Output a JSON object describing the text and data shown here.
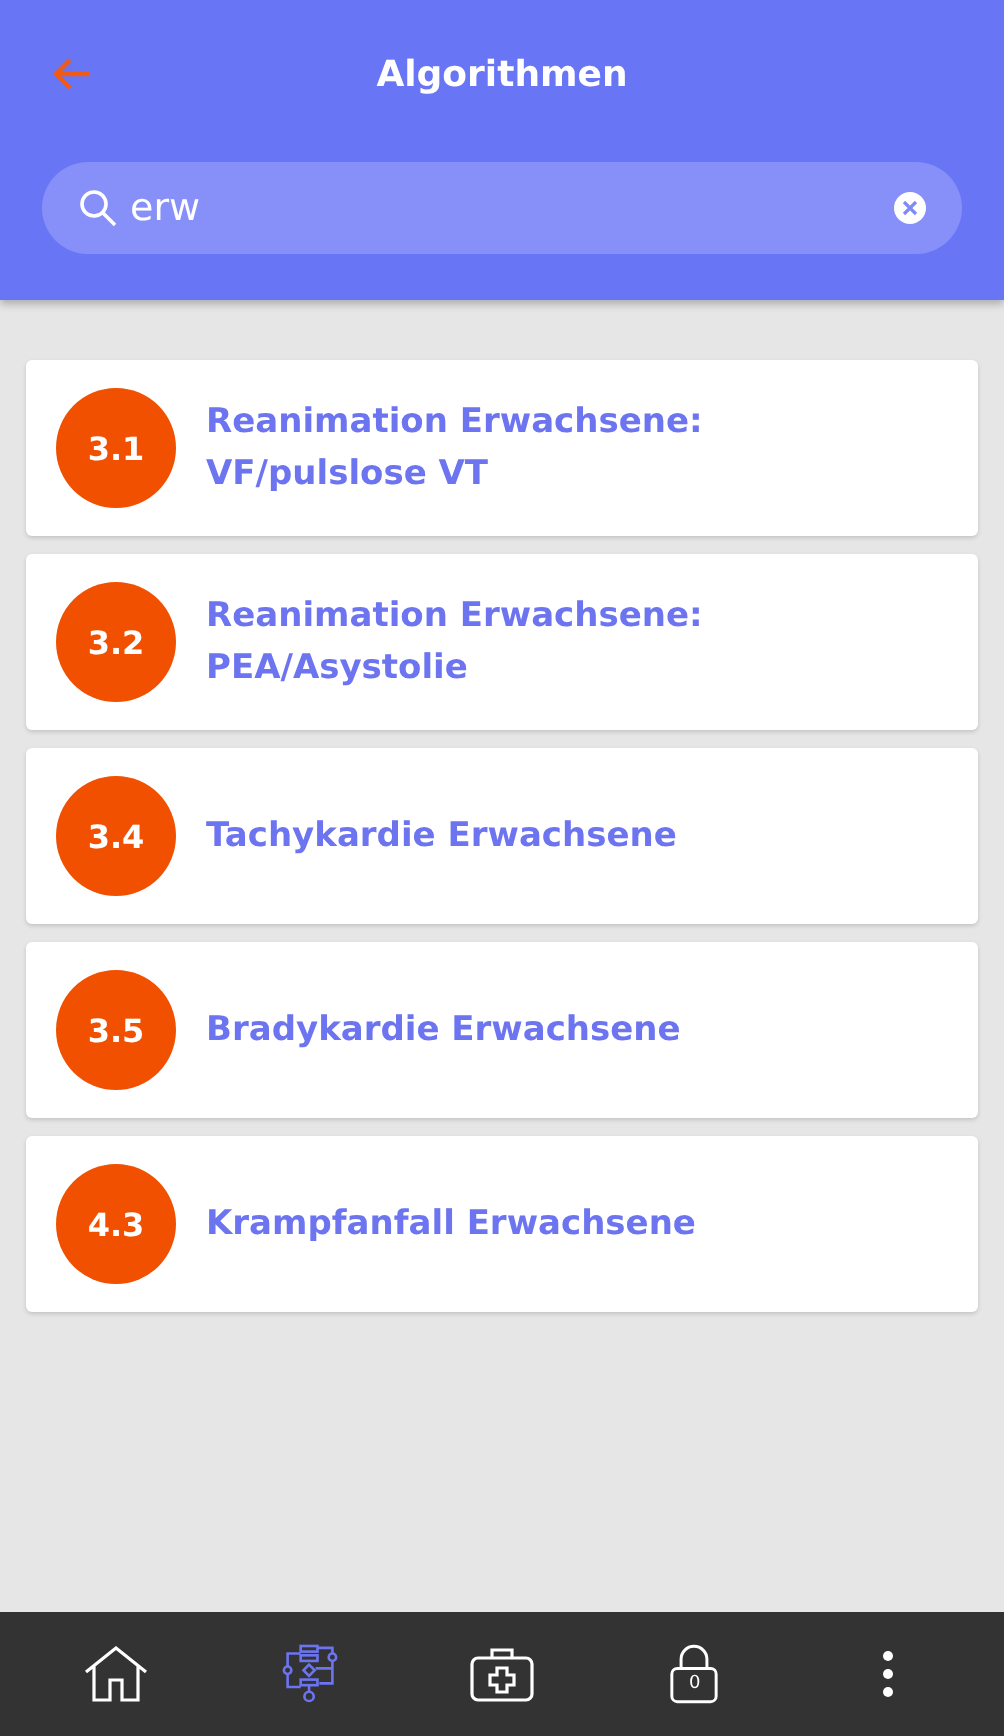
{
  "header": {
    "title": "Algorithmen"
  },
  "search": {
    "value": "erw"
  },
  "items": [
    {
      "number": "3.1",
      "title": "Reanimation Erwachsene: VF/pulslose VT"
    },
    {
      "number": "3.2",
      "title": "Reanimation Erwachsene: PEA/Asystolie"
    },
    {
      "number": "3.4",
      "title": "Tachykardie Erwachsene"
    },
    {
      "number": "3.5",
      "title": "Bradykardie Erwachsene"
    },
    {
      "number": "4.3",
      "title": "Krampfanfall Erwachsene"
    }
  ],
  "nav": [
    {
      "kind": "home",
      "selected": false
    },
    {
      "kind": "flowchart",
      "selected": true
    },
    {
      "kind": "medkit",
      "selected": false
    },
    {
      "kind": "lock",
      "selected": false,
      "badge": "0"
    },
    {
      "kind": "more",
      "selected": false
    }
  ]
}
